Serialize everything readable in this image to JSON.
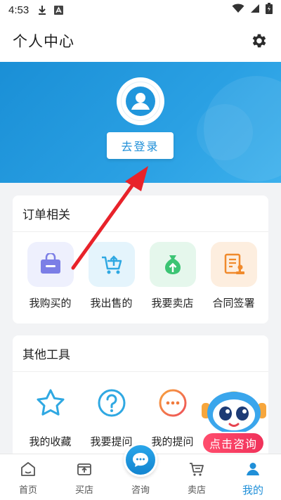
{
  "status_bar": {
    "time": "4:53"
  },
  "header": {
    "title": "个人中心",
    "settings_icon": "gear-icon"
  },
  "profile": {
    "login_label": "去登录",
    "avatar_icon": "user-avatar-icon"
  },
  "orders": {
    "title": "订单相关",
    "items": [
      {
        "label": "我购买的",
        "icon": "shopping-bag-icon",
        "bg": "#eef0fd",
        "color": "#6c6fd8"
      },
      {
        "label": "我出售的",
        "icon": "cart-upload-icon",
        "bg": "#e6f5fd",
        "color": "#2fa8e2"
      },
      {
        "label": "我要卖店",
        "icon": "money-bag-icon",
        "bg": "#e7f8ee",
        "color": "#3cc474"
      },
      {
        "label": "合同签署",
        "icon": "contract-stamp-icon",
        "bg": "#fdf1e6",
        "color": "#f08a2c"
      }
    ]
  },
  "tools": {
    "title": "其他工具",
    "items": [
      {
        "label": "我的收藏",
        "icon": "star-icon",
        "color": "#2fa8e2"
      },
      {
        "label": "我要提问",
        "icon": "question-icon",
        "color": "#2fa8e2"
      },
      {
        "label": "我的提问",
        "icon": "more-dots-icon",
        "color": "#f0743c"
      }
    ]
  },
  "floating_consult": {
    "label": "点击咨询",
    "icon": "robot-mascot-icon"
  },
  "bottom_nav": {
    "items": [
      {
        "label": "首页",
        "icon": "home-icon"
      },
      {
        "label": "买店",
        "icon": "store-upload-icon"
      },
      {
        "label": "咨询",
        "icon": "chat-bubble-icon"
      },
      {
        "label": "卖店",
        "icon": "cart-icon"
      },
      {
        "label": "我的",
        "icon": "user-icon"
      }
    ],
    "active_color": "#1f8fd8"
  },
  "colors": {
    "brand": "#1f8fd8",
    "banner": "#1a8fd6",
    "annotation_arrow": "#e8222a"
  }
}
